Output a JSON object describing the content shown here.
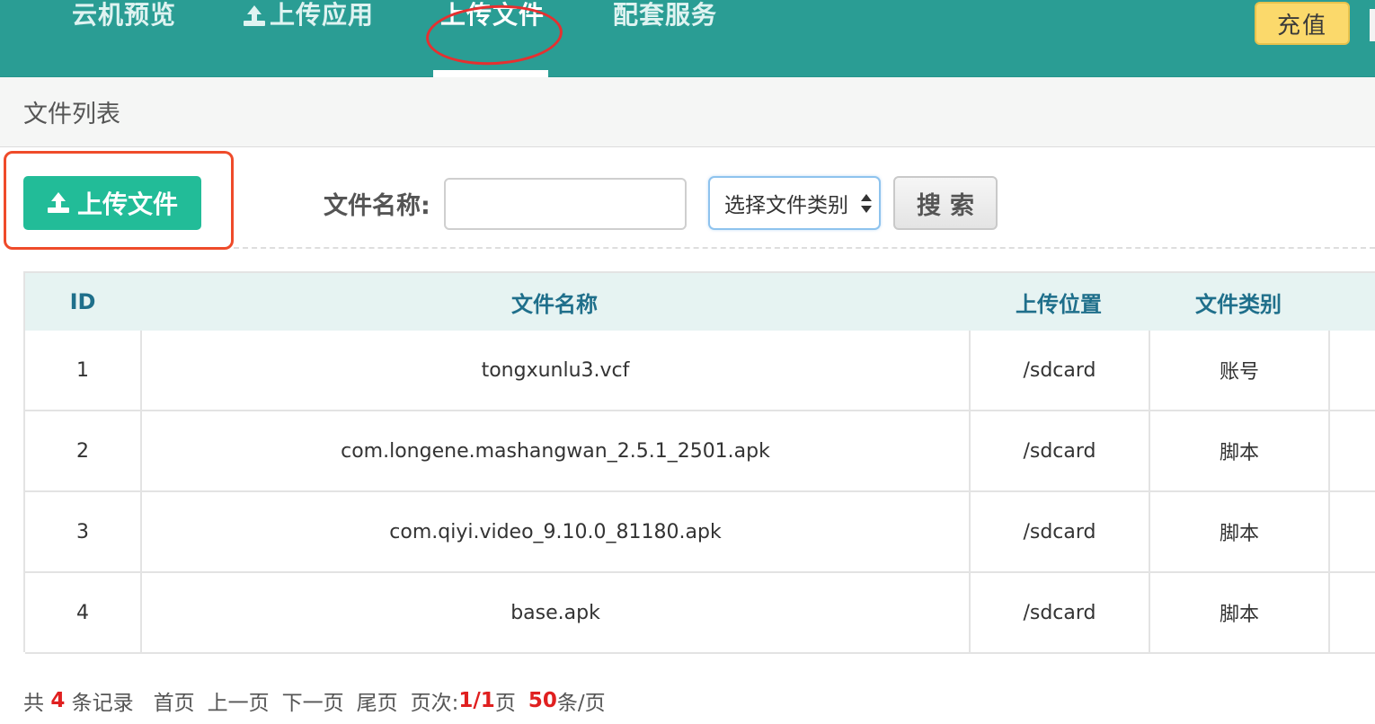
{
  "nav": {
    "items": [
      {
        "label": "云机预览"
      },
      {
        "label": "上传应用"
      },
      {
        "label": "上传文件"
      },
      {
        "label": "配套服务"
      }
    ],
    "active_index": 2,
    "recharge_label": "充值"
  },
  "panel": {
    "title": "文件列表"
  },
  "toolbar": {
    "upload_label": "上传文件",
    "filter_label": "文件名称:",
    "name_input_value": "",
    "category_select_value": "选择文件类别",
    "search_label": "搜索"
  },
  "table": {
    "headers": {
      "id": "ID",
      "name": "文件名称",
      "location": "上传位置",
      "category": "文件类别"
    },
    "rows": [
      {
        "id": "1",
        "name": "tongxunlu3.vcf",
        "location": "/sdcard",
        "category": "账号"
      },
      {
        "id": "2",
        "name": "com.longene.mashangwan_2.5.1_2501.apk",
        "location": "/sdcard",
        "category": "脚本"
      },
      {
        "id": "3",
        "name": "com.qiyi.video_9.10.0_81180.apk",
        "location": "/sdcard",
        "category": "脚本"
      },
      {
        "id": "4",
        "name": "base.apk",
        "location": "/sdcard",
        "category": "脚本"
      }
    ]
  },
  "pager": {
    "prefix": "共",
    "count": "4",
    "suffix": "条记录",
    "first": "首页",
    "prev": "上一页",
    "next": "下一页",
    "last": "尾页",
    "page_label": "页次:",
    "page_value": "1/1",
    "page_unit": "页",
    "per_page_value": "50",
    "per_page_unit": "条/页"
  },
  "colors": {
    "topbar": "#2a9d94",
    "upload_button": "#22bc98",
    "recharge_button": "#fbd96b",
    "header_text": "#1f6f8b",
    "annotation_red": "#e53030"
  }
}
